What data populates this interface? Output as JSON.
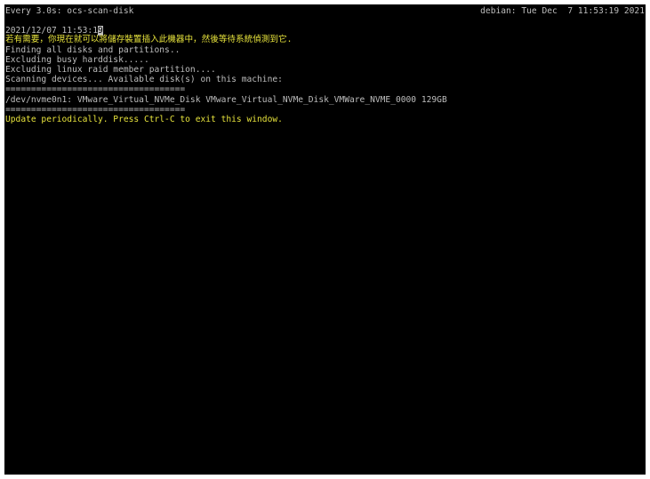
{
  "header": {
    "command": "Every 3.0s: ocs-scan-disk",
    "host_time": "debian: Tue Dec  7 11:53:19 2021"
  },
  "output": {
    "timestamp_prefix": "2021/12/07 11:53:1",
    "timestamp_cursor_char": "9",
    "notice": "若有需要，你現在就可以將儲存裝置插入此機器中，然後等待系統偵測到它.",
    "finding": "Finding all disks and partitions..",
    "excluding_busy": "Excluding busy harddisk.....",
    "excluding_raid": "Excluding linux raid member partition....",
    "scanning": "Scanning devices... Available disk(s) on this machine:",
    "separator_top": "===================================",
    "disk_entry": "/dev/nvme0n1: VMware_Virtual_NVMe_Disk VMware_Virtual_NVMe_Disk_VMWare_NVME_0000 129GB",
    "separator_bottom": "===================================",
    "update_hint": "Update periodically. Press Ctrl-C to exit this window."
  },
  "colors": {
    "background": "#000000",
    "text": "#bdbdbd",
    "highlight": "#e6e23c"
  }
}
